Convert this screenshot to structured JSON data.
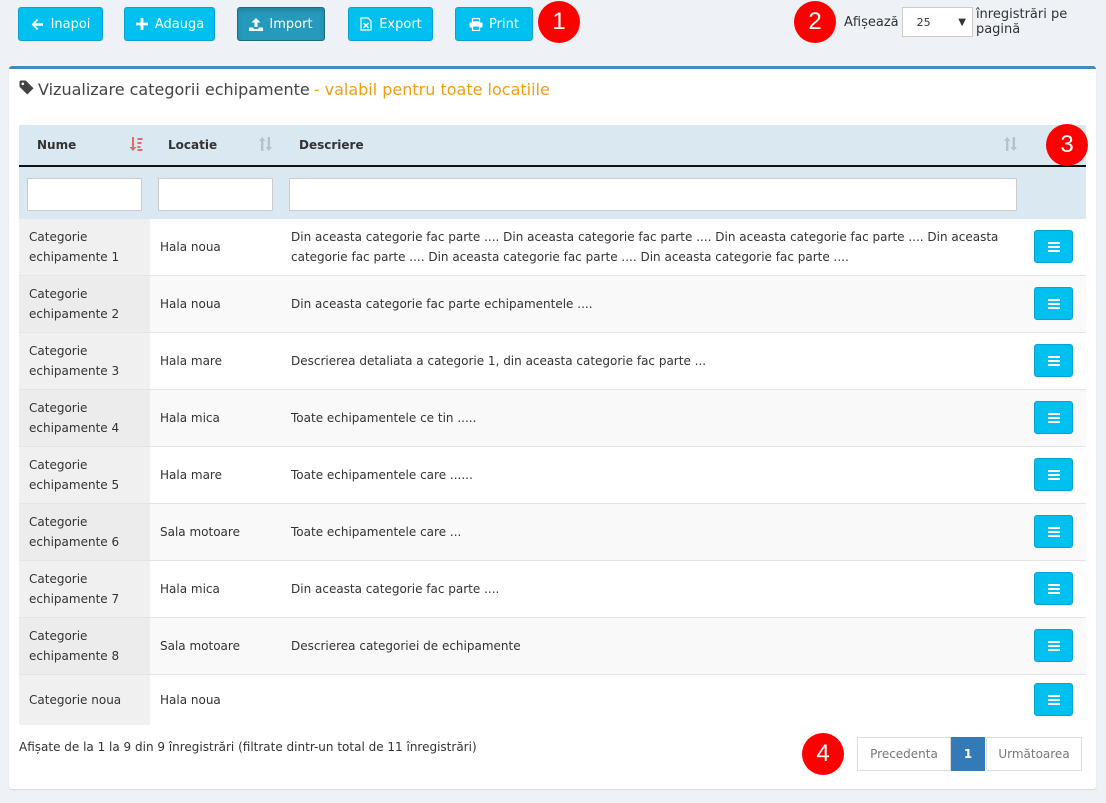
{
  "toolbar": {
    "back_label": "Inapoi",
    "add_label": "Adauga",
    "import_label": "Import",
    "export_label": "Export",
    "print_label": "Print"
  },
  "markers": [
    "1",
    "2",
    "3",
    "4"
  ],
  "page_size": {
    "prefix": "Afișează",
    "value": "25",
    "suffix": "înregistrări pe pagină"
  },
  "panel": {
    "title": "Vizualizare categorii echipamente",
    "subtitle": "- valabil pentru toate locatiile"
  },
  "table": {
    "headers": [
      "Nume",
      "Locatie",
      "Descriere"
    ],
    "rows": [
      {
        "name": "Categorie echipamente 1",
        "location": "Hala noua",
        "description": "Din aceasta categorie fac parte .... Din aceasta categorie fac parte .... Din aceasta categorie fac parte .... Din aceasta categorie fac parte .... Din aceasta categorie fac parte .... Din aceasta categorie fac parte ...."
      },
      {
        "name": "Categorie echipamente 2",
        "location": "Hala noua",
        "description": "Din aceasta categorie fac parte echipamentele ...."
      },
      {
        "name": "Categorie echipamente 3",
        "location": "Hala mare",
        "description": "Descrierea detaliata a categorie 1, din aceasta categorie fac parte ..."
      },
      {
        "name": "Categorie echipamente 4",
        "location": "Hala mica",
        "description": "Toate echipamentele ce tin ....."
      },
      {
        "name": "Categorie echipamente 5",
        "location": "Hala mare",
        "description": "Toate echipamentele care ......"
      },
      {
        "name": "Categorie echipamente 6",
        "location": "Sala motoare",
        "description": "Toate echipamentele care ..."
      },
      {
        "name": "Categorie echipamente 7",
        "location": "Hala mica",
        "description": "Din aceasta categorie fac parte ...."
      },
      {
        "name": "Categorie echipamente 8",
        "location": "Sala motoare",
        "description": "Descrierea categoriei de echipamente"
      },
      {
        "name": "Categorie noua",
        "location": "Hala noua",
        "description": ""
      }
    ]
  },
  "footer": {
    "info": "Afișate de la 1 la 9 din 9 înregistrări (filtrate dintr-un total de 11 înregistrări)",
    "prev_label": "Precedenta",
    "current_page": "1",
    "next_label": "Următoarea"
  },
  "colors": {
    "button": "#00c0ef",
    "marker": "#ff0000",
    "accent": "#3c8dbc",
    "subtitle": "#f39c12",
    "pager_active": "#337ab7"
  },
  "icons": {
    "back": "arrow-left-icon",
    "add": "plus-icon",
    "import": "upload-icon",
    "export": "excel-file-icon",
    "print": "printer-icon",
    "title": "tag-icon",
    "sort_active": "sort-amount-down-icon",
    "sort": "sort-icon",
    "row_action": "bars-icon"
  }
}
